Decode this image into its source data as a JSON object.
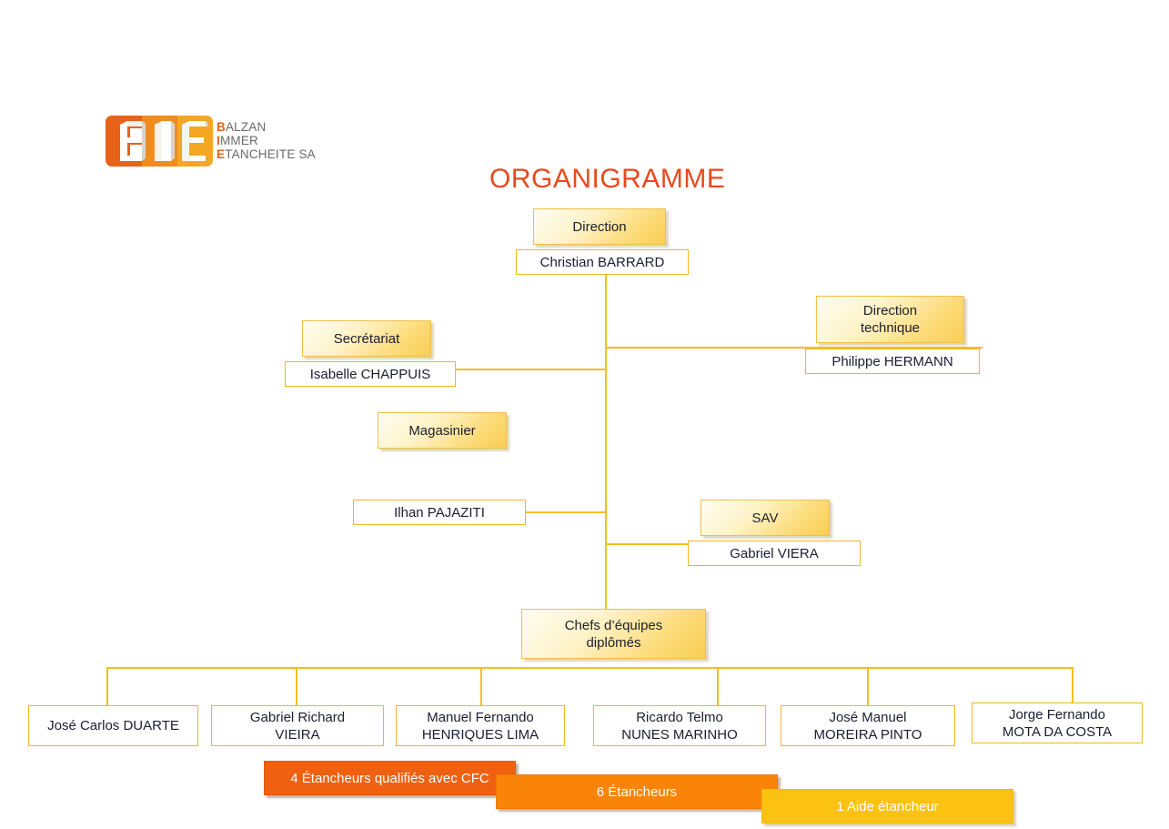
{
  "page": {
    "title": "ORGANIGRAMME",
    "title_color": "#E8491E",
    "background": "#ffffff"
  },
  "logo": {
    "mark_text": "BIE",
    "band_colors": [
      "#e8621a",
      "#f08c1e",
      "#f5a623"
    ],
    "lines": [
      {
        "cap": "B",
        "rest": "ALZAN"
      },
      {
        "cap": "I",
        "rest": "MMER"
      },
      {
        "cap": "E",
        "rest": "TANCHEITE SA"
      }
    ]
  },
  "nodes": {
    "direction": {
      "role": "Direction",
      "name": "Christian BARRARD"
    },
    "direction_technique": {
      "role": "Direction technique",
      "role_line1": "Direction",
      "role_line2": "technique",
      "name": "Philippe HERMANN"
    },
    "secretariat": {
      "role": "Secrétariat",
      "name": "Isabelle CHAPPUIS"
    },
    "magasinier": {
      "role": "Magasinier",
      "name": "Ilhan PAJAZITI"
    },
    "sav": {
      "role": "SAV",
      "name": "Gabriel VIERA"
    },
    "chefs": {
      "role": "Chefs d’équipes diplômés",
      "role_line1": "Chefs d’équipes",
      "role_line2": "diplômés"
    }
  },
  "team_leaders": [
    {
      "line1": "José Carlos DUARTE",
      "line2": ""
    },
    {
      "line1": "Gabriel Richard",
      "line2": "VIEIRA"
    },
    {
      "line1": "Manuel Fernando",
      "line2": "HENRIQUES LIMA"
    },
    {
      "line1": "Ricardo Telmo",
      "line2": "NUNES MARINHO"
    },
    {
      "line1": "José Manuel",
      "line2": "MOREIRA PINTO"
    },
    {
      "line1": "Jorge Fernando",
      "line2": "MOTA DA COSTA"
    }
  ],
  "workforce_bars": [
    {
      "label": "4 Étancheurs qualifiés avec CFC",
      "color": "#EF6111"
    },
    {
      "label": "6 Étancheurs",
      "color": "#F98407"
    },
    {
      "label": "1 Aide étancheur",
      "color": "#FCC211"
    }
  ],
  "connector_color": "#F5BE1E"
}
